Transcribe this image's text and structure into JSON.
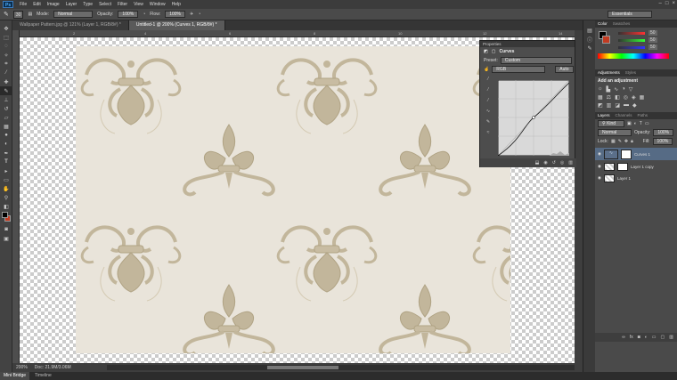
{
  "app": {
    "logo": "Ps",
    "workspace": "Essentials"
  },
  "menu": [
    "File",
    "Edit",
    "Image",
    "Layer",
    "Type",
    "Select",
    "Filter",
    "View",
    "Window",
    "Help"
  ],
  "options": {
    "brush_size": "30",
    "mode_label": "Mode:",
    "mode": "Normal",
    "opacity_label": "Opacity:",
    "opacity": "100%",
    "flow_label": "Flow:",
    "flow": "100%"
  },
  "tabs": [
    {
      "label": "Wallpaper Pattern.jpg @ 121% (Layer 1, RGB/8#) *"
    },
    {
      "label": "Untitled-1 @ 200% (Curves 1, RGB/8#) *"
    }
  ],
  "ruler": {
    "ticks": [
      "2",
      "4",
      "6",
      "8",
      "10",
      "12",
      "14"
    ]
  },
  "status": {
    "zoom": "200%",
    "doc": "Doc: 21.9M/3.06M"
  },
  "bottom_tabs": [
    "Mini Bridge",
    "Timeline"
  ],
  "properties": {
    "title": "Properties",
    "panel_name": "Curves",
    "preset_label": "Preset:",
    "preset": "Custom",
    "channel": "RGB",
    "auto": "Auto"
  },
  "color_panel": {
    "tabs": [
      "Color",
      "Swatches"
    ],
    "r": "50",
    "g": "50",
    "b": "50"
  },
  "adjustments": {
    "tabs": [
      "Adjustments",
      "Styles"
    ],
    "heading": "Add an adjustment"
  },
  "layers_panel": {
    "tabs": [
      "Layers",
      "Channels",
      "Paths"
    ],
    "filter": "Kind",
    "blend": "Normal",
    "opacity_label": "Opacity:",
    "opacity": "100%",
    "lock_label": "Lock:",
    "fill_label": "Fill:",
    "fill": "100%",
    "layers": [
      {
        "name": "Curves 1"
      },
      {
        "name": "Layer 1 copy"
      },
      {
        "name": "Layer 1"
      }
    ]
  },
  "colors": {
    "accent": "#4fb0ff",
    "bg": "#535353",
    "paper": "#e9e4da",
    "motif": "#c2b69b"
  }
}
